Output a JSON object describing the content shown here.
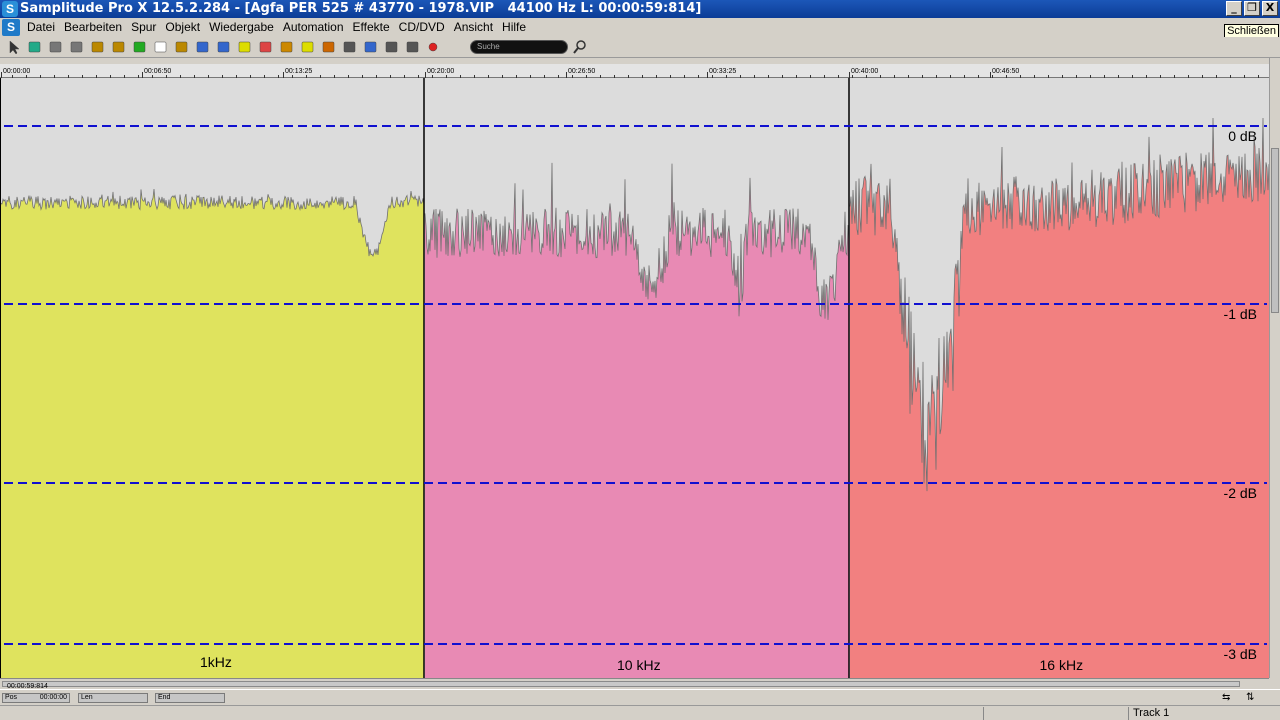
{
  "window": {
    "title": "Samplitude Pro X 12.5.2.284 - [Agfa PER 525 # 43770 - 1978.VIP   44100 Hz L: 00:00:59:814]",
    "logo_letter": "S",
    "minimize": "_",
    "restore": "❐",
    "close": "X"
  },
  "menu": {
    "logo_letter": "S",
    "items": [
      "Datei",
      "Bearbeiten",
      "Spur",
      "Objekt",
      "Wiedergabe",
      "Automation",
      "Effekte",
      "CD/DVD",
      "Ansicht",
      "Hilfe"
    ],
    "close_tooltip": "Schließen"
  },
  "toolbar": {
    "search_placeholder": "Suche",
    "icons": [
      "pointer-icon",
      "cut-icon",
      "undo-icon",
      "redo-icon",
      "list-icon",
      "list-icon-2",
      "grid-icon",
      "select-icon",
      "hand-icon",
      "zoom-icon",
      "draw-icon",
      "pencil-icon",
      "eraser-icon",
      "scrub-icon",
      "fade-icon",
      "snap-icon",
      "marker-icon",
      "loop-icon",
      "monitor-icon",
      "settings-icon",
      "record-icon"
    ]
  },
  "ruler": {
    "labels": [
      "00:00:00",
      "00:06:50",
      "00:13:25",
      "00:20:00",
      "00:26:50",
      "00:33:25",
      "00:40:00",
      "00:46:50"
    ]
  },
  "regions": [
    {
      "label": "1kHz",
      "color": "#dfe35e",
      "level_db": -0.43,
      "dip_db": -0.72
    },
    {
      "label": "10 kHz",
      "color": "#e88ab4",
      "level_db": -0.6,
      "dip_db": -1.15
    },
    {
      "label": "16 kHz",
      "color": "#f28080",
      "level_db": -0.45,
      "dip_db": -1.9
    }
  ],
  "db_lines": [
    {
      "label": "0 dB",
      "db": 0
    },
    {
      "label": "-1 dB",
      "db": -1
    },
    {
      "label": "-2 dB",
      "db": -2
    },
    {
      "label": "-3 dB",
      "db": -3
    }
  ],
  "colors": {
    "grid_line": "#1010d0",
    "wave_outline": "#707070",
    "background": "#dcdcdc"
  },
  "scroll": {
    "h_label": "00:00:59:814"
  },
  "position_bar": {
    "pos_label": "Pos",
    "pos_value": "00:00:00",
    "len_label": "Len",
    "end_label": "End"
  },
  "status": {
    "track": "Track 1"
  }
}
